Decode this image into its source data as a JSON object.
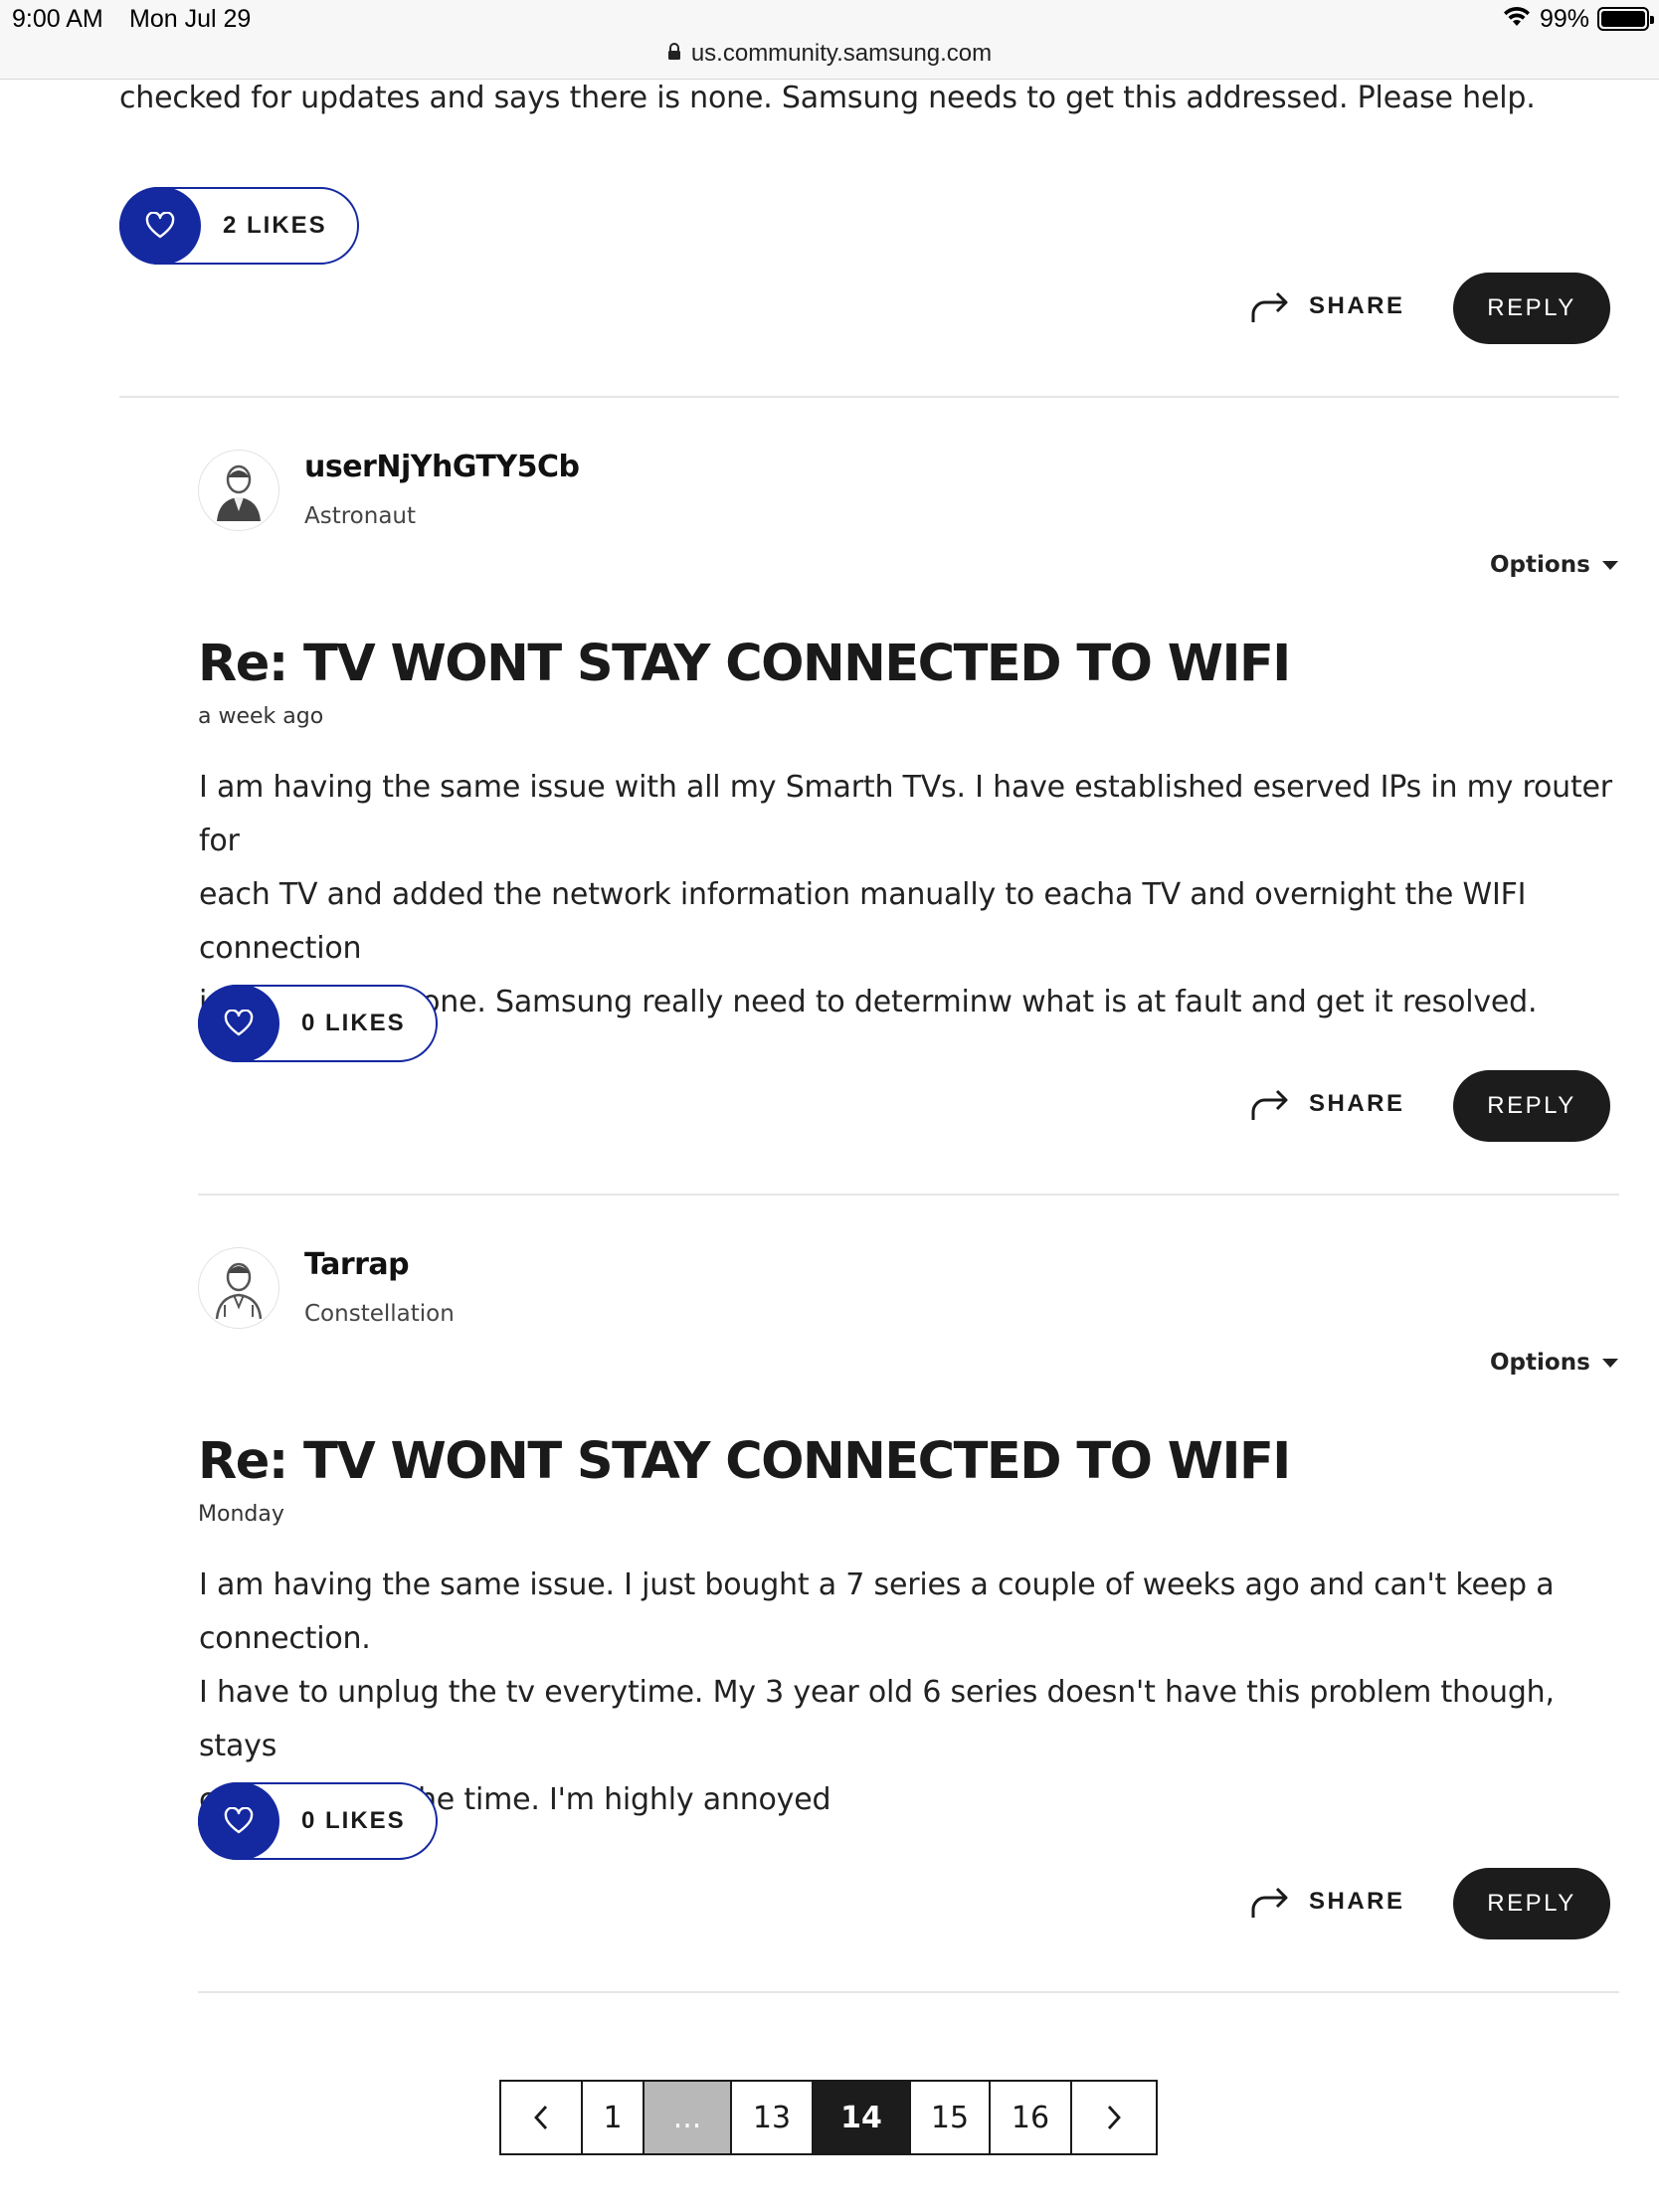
{
  "status_bar": {
    "time": "9:00 AM",
    "date": "Mon Jul 29",
    "battery": "99%",
    "battery_level": 0.99,
    "url": "us.community.samsung.com"
  },
  "top_post": {
    "body_tail": "checked for updates and says there is none. Samsung needs to get this addressed. Please help.",
    "likes": "2 LIKES",
    "share_label": "SHARE",
    "reply_label": "REPLY"
  },
  "posts": [
    {
      "username": "userNjYhGTY5Cb",
      "rank": "Astronaut",
      "options_label": "Options",
      "title": "Re: TV WONT STAY CONNECTED TO WIFI",
      "date": "a week ago",
      "body_lines": [
        "I am having the same issue with all my Smarth TVs. I have established eserved IPs in my router for",
        "each TV and added the network information manually to eacha TV and overnight the WIFI connection",
        "is once again gone. Samsung really need to determinw what is at fault and get it resolved."
      ],
      "likes": "0 LIKES",
      "share_label": "SHARE",
      "reply_label": "REPLY"
    },
    {
      "username": "Tarrap",
      "rank": "Constellation",
      "options_label": "Options",
      "title": "Re: TV WONT STAY CONNECTED TO WIFI",
      "date": "Monday",
      "body_lines": [
        "I am having the same issue. I just bought a 7 series a couple of weeks ago and can't keep a connection.",
        "I have to unplug the tv everytime. My 3 year old 6 series doesn't have this problem though,  stays",
        "connected all the time. I'm highly annoyed"
      ],
      "likes": "0 LIKES",
      "share_label": "SHARE",
      "reply_label": "REPLY"
    }
  ],
  "pagination": {
    "pages": [
      "1",
      "...",
      "13",
      "14",
      "15",
      "16"
    ],
    "current": "14"
  },
  "colors": {
    "like_blue": "#1428a0",
    "reply_bg": "#1c1c1c",
    "ellipsis_bg": "#b8b8b8"
  }
}
